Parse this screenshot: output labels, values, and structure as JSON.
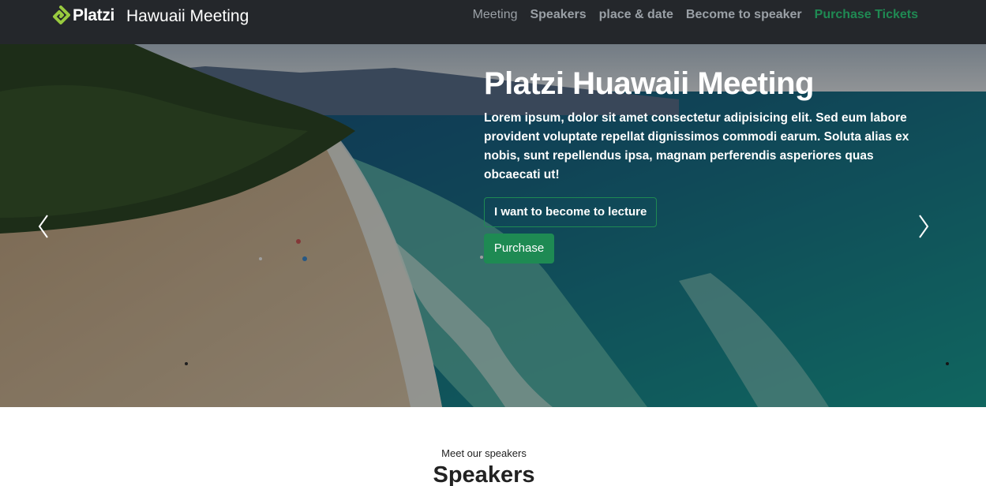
{
  "navbar": {
    "logo_text": "Platzi",
    "site_title": "Hawuaii Meeting",
    "links": [
      {
        "label": "Meeting"
      },
      {
        "label": "Speakers"
      },
      {
        "label": "place & date"
      },
      {
        "label": "Become to speaker"
      },
      {
        "label": "Purchase Tickets"
      }
    ]
  },
  "hero": {
    "title": "Platzi Huawaii Meeting",
    "text": "Lorem ipsum, dolor sit amet consectetur adipisicing elit. Sed eum labore provident voluptate repellat dignissimos commodi earum. Soluta alias ex nobis, sunt repellendus ipsa, magnam perferendis asperiores quas obcaecati ut!",
    "lecture_button": "I want to become to lecture",
    "purchase_button": "Purchase",
    "prev_icon": "chevron-left-icon",
    "next_icon": "chevron-right-icon"
  },
  "speakers": {
    "kicker": "Meet our speakers",
    "heading": "Speakers"
  },
  "colors": {
    "navbar_bg": "#24272b",
    "accent_green": "#1e8a53",
    "nav_link": "#9aa0a6"
  }
}
